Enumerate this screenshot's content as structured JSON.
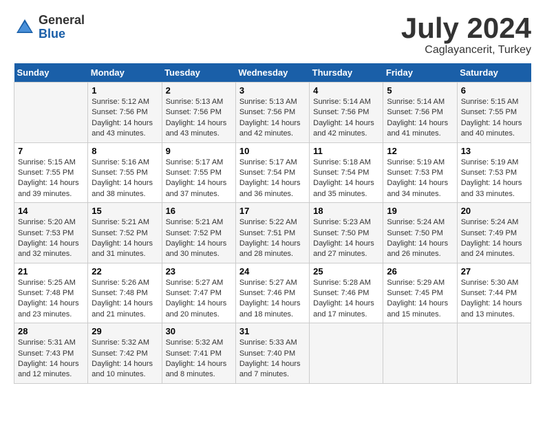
{
  "header": {
    "logo_general": "General",
    "logo_blue": "Blue",
    "month": "July 2024",
    "location": "Caglayancerit, Turkey"
  },
  "calendar": {
    "days_of_week": [
      "Sunday",
      "Monday",
      "Tuesday",
      "Wednesday",
      "Thursday",
      "Friday",
      "Saturday"
    ],
    "weeks": [
      [
        {
          "day": "",
          "info": ""
        },
        {
          "day": "1",
          "info": "Sunrise: 5:12 AM\nSunset: 7:56 PM\nDaylight: 14 hours\nand 43 minutes."
        },
        {
          "day": "2",
          "info": "Sunrise: 5:13 AM\nSunset: 7:56 PM\nDaylight: 14 hours\nand 43 minutes."
        },
        {
          "day": "3",
          "info": "Sunrise: 5:13 AM\nSunset: 7:56 PM\nDaylight: 14 hours\nand 42 minutes."
        },
        {
          "day": "4",
          "info": "Sunrise: 5:14 AM\nSunset: 7:56 PM\nDaylight: 14 hours\nand 42 minutes."
        },
        {
          "day": "5",
          "info": "Sunrise: 5:14 AM\nSunset: 7:56 PM\nDaylight: 14 hours\nand 41 minutes."
        },
        {
          "day": "6",
          "info": "Sunrise: 5:15 AM\nSunset: 7:55 PM\nDaylight: 14 hours\nand 40 minutes."
        }
      ],
      [
        {
          "day": "7",
          "info": "Sunrise: 5:15 AM\nSunset: 7:55 PM\nDaylight: 14 hours\nand 39 minutes."
        },
        {
          "day": "8",
          "info": "Sunrise: 5:16 AM\nSunset: 7:55 PM\nDaylight: 14 hours\nand 38 minutes."
        },
        {
          "day": "9",
          "info": "Sunrise: 5:17 AM\nSunset: 7:55 PM\nDaylight: 14 hours\nand 37 minutes."
        },
        {
          "day": "10",
          "info": "Sunrise: 5:17 AM\nSunset: 7:54 PM\nDaylight: 14 hours\nand 36 minutes."
        },
        {
          "day": "11",
          "info": "Sunrise: 5:18 AM\nSunset: 7:54 PM\nDaylight: 14 hours\nand 35 minutes."
        },
        {
          "day": "12",
          "info": "Sunrise: 5:19 AM\nSunset: 7:53 PM\nDaylight: 14 hours\nand 34 minutes."
        },
        {
          "day": "13",
          "info": "Sunrise: 5:19 AM\nSunset: 7:53 PM\nDaylight: 14 hours\nand 33 minutes."
        }
      ],
      [
        {
          "day": "14",
          "info": "Sunrise: 5:20 AM\nSunset: 7:53 PM\nDaylight: 14 hours\nand 32 minutes."
        },
        {
          "day": "15",
          "info": "Sunrise: 5:21 AM\nSunset: 7:52 PM\nDaylight: 14 hours\nand 31 minutes."
        },
        {
          "day": "16",
          "info": "Sunrise: 5:21 AM\nSunset: 7:52 PM\nDaylight: 14 hours\nand 30 minutes."
        },
        {
          "day": "17",
          "info": "Sunrise: 5:22 AM\nSunset: 7:51 PM\nDaylight: 14 hours\nand 28 minutes."
        },
        {
          "day": "18",
          "info": "Sunrise: 5:23 AM\nSunset: 7:50 PM\nDaylight: 14 hours\nand 27 minutes."
        },
        {
          "day": "19",
          "info": "Sunrise: 5:24 AM\nSunset: 7:50 PM\nDaylight: 14 hours\nand 26 minutes."
        },
        {
          "day": "20",
          "info": "Sunrise: 5:24 AM\nSunset: 7:49 PM\nDaylight: 14 hours\nand 24 minutes."
        }
      ],
      [
        {
          "day": "21",
          "info": "Sunrise: 5:25 AM\nSunset: 7:48 PM\nDaylight: 14 hours\nand 23 minutes."
        },
        {
          "day": "22",
          "info": "Sunrise: 5:26 AM\nSunset: 7:48 PM\nDaylight: 14 hours\nand 21 minutes."
        },
        {
          "day": "23",
          "info": "Sunrise: 5:27 AM\nSunset: 7:47 PM\nDaylight: 14 hours\nand 20 minutes."
        },
        {
          "day": "24",
          "info": "Sunrise: 5:27 AM\nSunset: 7:46 PM\nDaylight: 14 hours\nand 18 minutes."
        },
        {
          "day": "25",
          "info": "Sunrise: 5:28 AM\nSunset: 7:46 PM\nDaylight: 14 hours\nand 17 minutes."
        },
        {
          "day": "26",
          "info": "Sunrise: 5:29 AM\nSunset: 7:45 PM\nDaylight: 14 hours\nand 15 minutes."
        },
        {
          "day": "27",
          "info": "Sunrise: 5:30 AM\nSunset: 7:44 PM\nDaylight: 14 hours\nand 13 minutes."
        }
      ],
      [
        {
          "day": "28",
          "info": "Sunrise: 5:31 AM\nSunset: 7:43 PM\nDaylight: 14 hours\nand 12 minutes."
        },
        {
          "day": "29",
          "info": "Sunrise: 5:32 AM\nSunset: 7:42 PM\nDaylight: 14 hours\nand 10 minutes."
        },
        {
          "day": "30",
          "info": "Sunrise: 5:32 AM\nSunset: 7:41 PM\nDaylight: 14 hours\nand 8 minutes."
        },
        {
          "day": "31",
          "info": "Sunrise: 5:33 AM\nSunset: 7:40 PM\nDaylight: 14 hours\nand 7 minutes."
        },
        {
          "day": "",
          "info": ""
        },
        {
          "day": "",
          "info": ""
        },
        {
          "day": "",
          "info": ""
        }
      ]
    ]
  }
}
